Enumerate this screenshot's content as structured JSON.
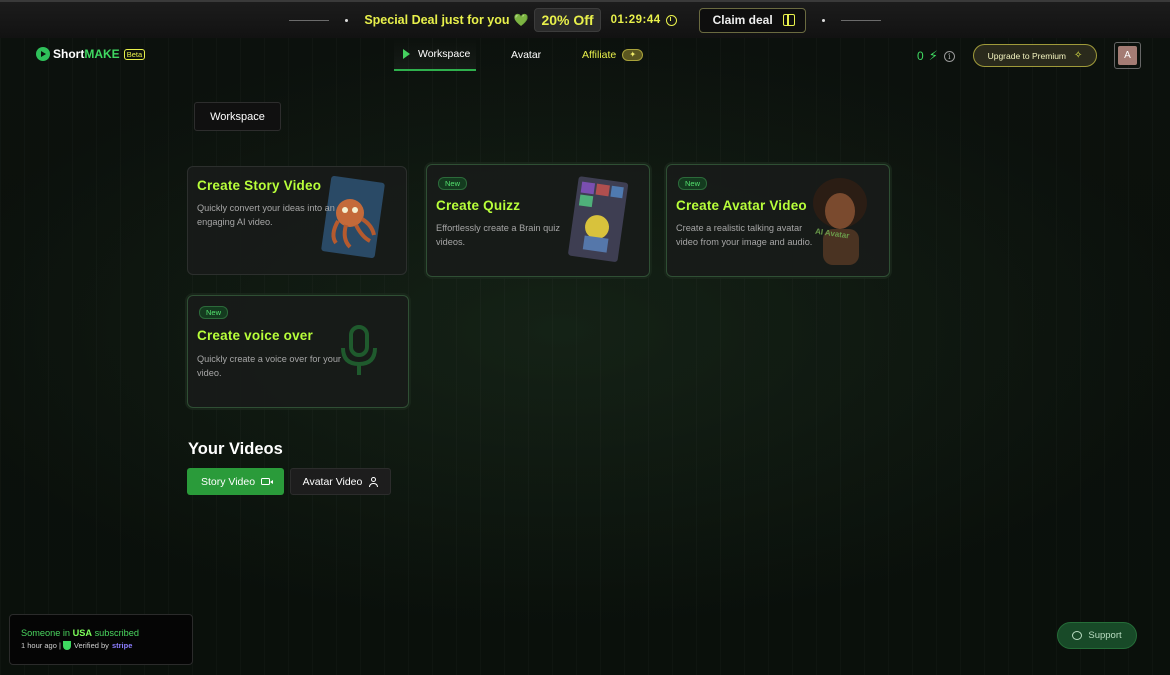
{
  "promo": {
    "deal_text": "Special Deal just for you",
    "heart_icon": "💚",
    "discount": "20% Off",
    "timer": "01:29:44",
    "claim_label": "Claim deal"
  },
  "nav": {
    "logo_short": "Short",
    "logo_make": "MAKE",
    "logo_beta": "Beta",
    "tabs": [
      {
        "label": "Workspace"
      },
      {
        "label": "Avatar"
      },
      {
        "label": "Affiliate"
      }
    ],
    "credits": "0",
    "upgrade_label": "Upgrade to Premium",
    "avatar_initial": "A"
  },
  "workspace_button": "Workspace",
  "cards": [
    {
      "title": "Create Story Video",
      "desc": "Quickly convert your ideas into an engaging AI video.",
      "badge": ""
    },
    {
      "title": "Create Quizz",
      "desc": "Effortlessly create a Brain quiz videos.",
      "badge": "New"
    },
    {
      "title": "Create Avatar Video",
      "desc": "Create a realistic talking avatar video from your image and audio.",
      "badge": "New",
      "art_label": "AI Avatar"
    },
    {
      "title": "Create voice over",
      "desc": "Quickly create a voice over for your video.",
      "badge": "New"
    }
  ],
  "your_videos": {
    "title": "Your Videos",
    "tabs": [
      {
        "label": "Story Video"
      },
      {
        "label": "Avatar Video"
      }
    ]
  },
  "toast": {
    "prefix": "Someone in",
    "country": "USA",
    "suffix": "subscribed",
    "time": "1 hour ago |",
    "verified": "Verified by",
    "stripe": "stripe"
  },
  "support_label": "Support",
  "colors": {
    "accent_green": "#2fb04d",
    "highlight_yellow": "#e8f04b",
    "card_title": "#b8ff3a",
    "background": "#0b120d"
  }
}
